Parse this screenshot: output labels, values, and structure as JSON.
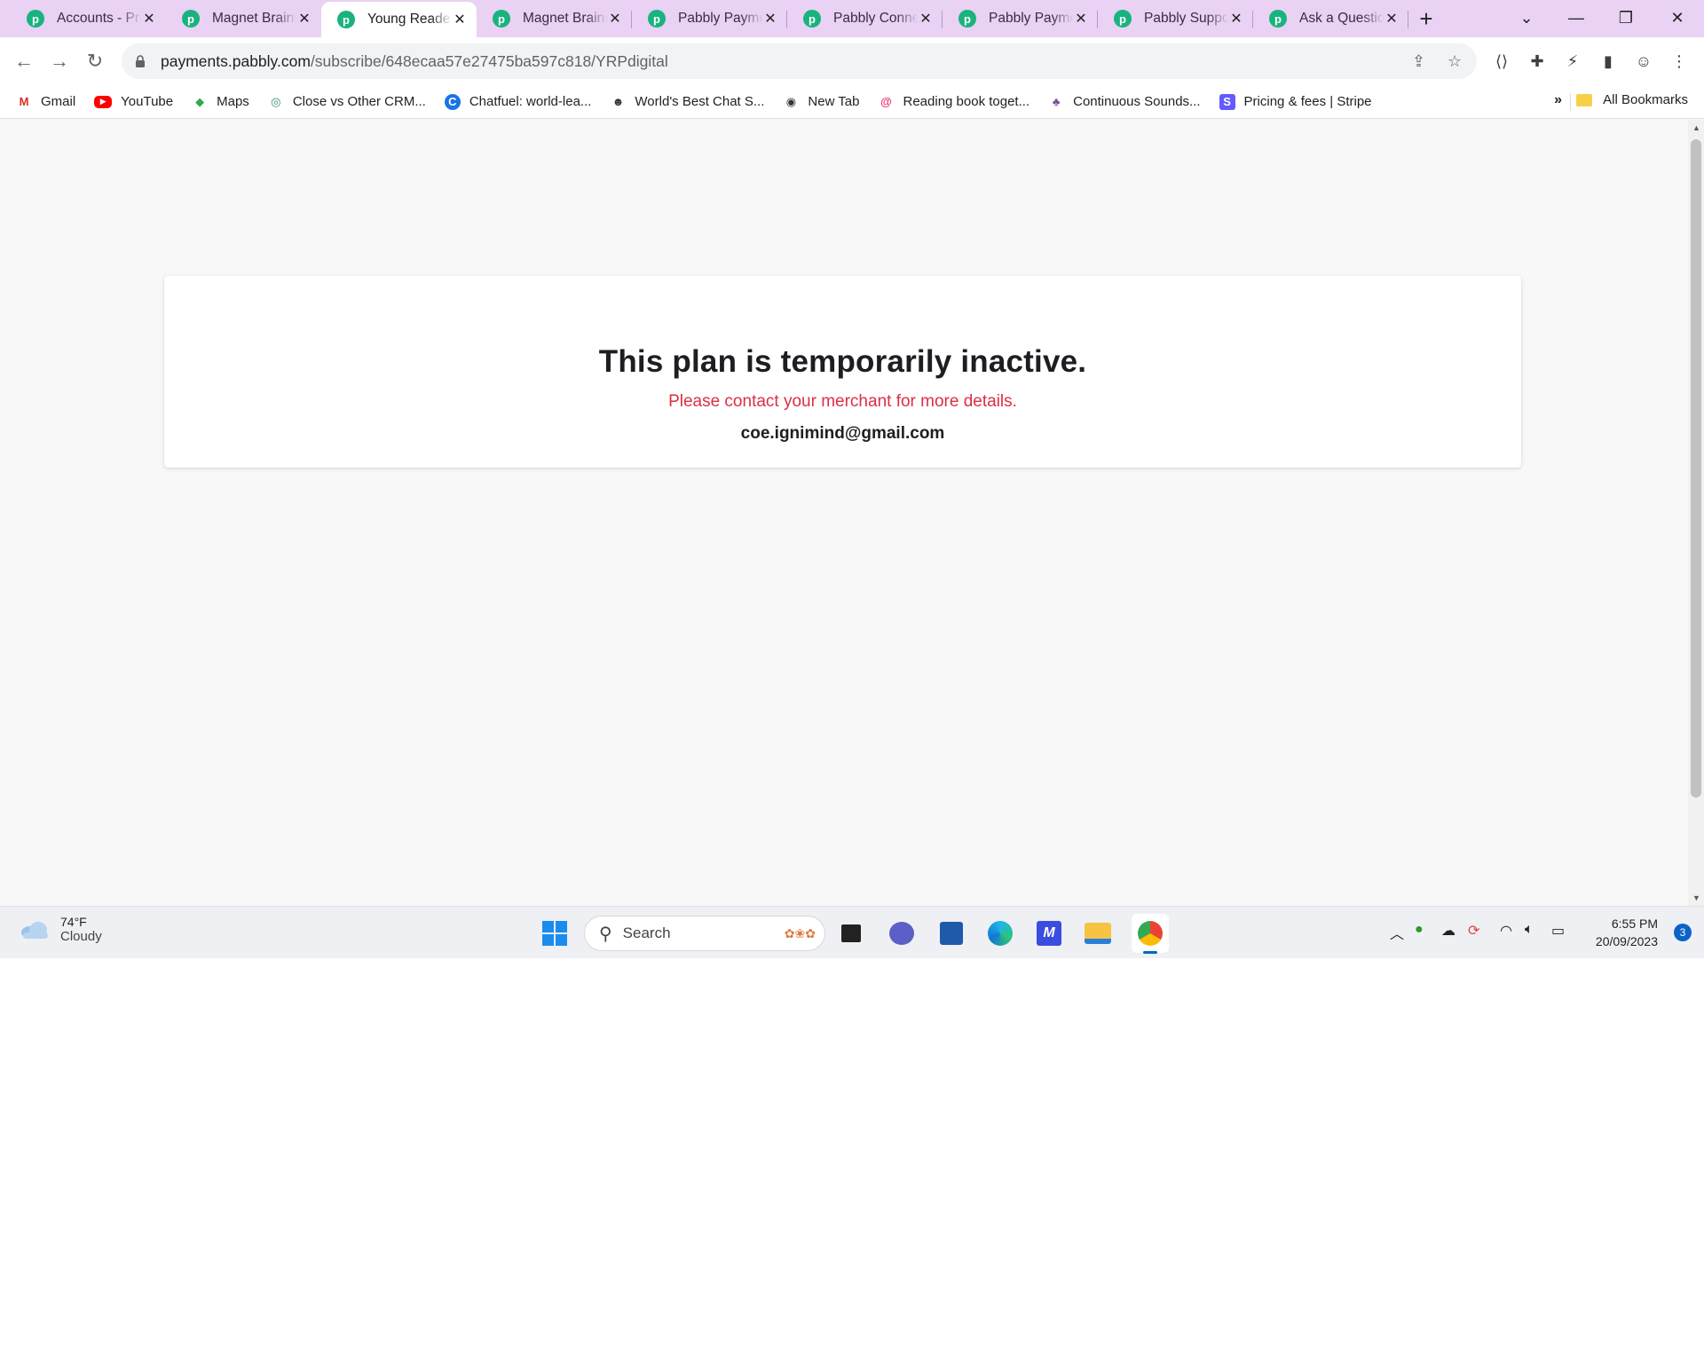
{
  "browser": {
    "tabs": [
      {
        "title": "Accounts - Pro",
        "active": false
      },
      {
        "title": "Magnet Brains",
        "active": false
      },
      {
        "title": "Young Reader",
        "active": true
      },
      {
        "title": "Magnet Brains",
        "active": false
      },
      {
        "title": "Pabbly Payments",
        "active": false
      },
      {
        "title": "Pabbly Connect",
        "active": false
      },
      {
        "title": "Pabbly Payments",
        "active": false
      },
      {
        "title": "Pabbly Support",
        "active": false
      },
      {
        "title": "Ask a Question",
        "active": false
      }
    ],
    "tab_favicon_letter": "p",
    "url_host": "payments.pabbly.com",
    "url_path": "/subscribe/648ecaa57e27475ba597c818/YRPdigital",
    "bookmarks": [
      {
        "label": "Gmail",
        "icon": "gmail-icon"
      },
      {
        "label": "YouTube",
        "icon": "youtube-icon"
      },
      {
        "label": "Maps",
        "icon": "maps-icon"
      },
      {
        "label": "Close vs Other CRM...",
        "icon": "close-crm-icon"
      },
      {
        "label": "Chatfuel: world-lea...",
        "icon": "chatfuel-icon"
      },
      {
        "label": "World's Best Chat S...",
        "icon": "chat-icon"
      },
      {
        "label": "New Tab",
        "icon": "globe-icon"
      },
      {
        "label": "Reading book toget...",
        "icon": "reading-icon"
      },
      {
        "label": "Continuous Sounds...",
        "icon": "sounds-icon"
      },
      {
        "label": "Pricing & fees | Stripe",
        "icon": "stripe-icon"
      }
    ],
    "all_bookmarks_label": "All Bookmarks"
  },
  "page": {
    "heading": "This plan is temporarily inactive.",
    "message": "Please contact your merchant for more details.",
    "email": "coe.ignimind@gmail.com"
  },
  "taskbar": {
    "weather_temp": "74°F",
    "weather_desc": "Cloudy",
    "search_label": "Search",
    "time": "6:55 PM",
    "date": "20/09/2023",
    "notification_count": "3"
  },
  "colors": {
    "tabstrip": "#e9d2f4",
    "favicon": "#19b37e",
    "message_red": "#dd2e44",
    "page_bg": "#f8f8f8"
  }
}
